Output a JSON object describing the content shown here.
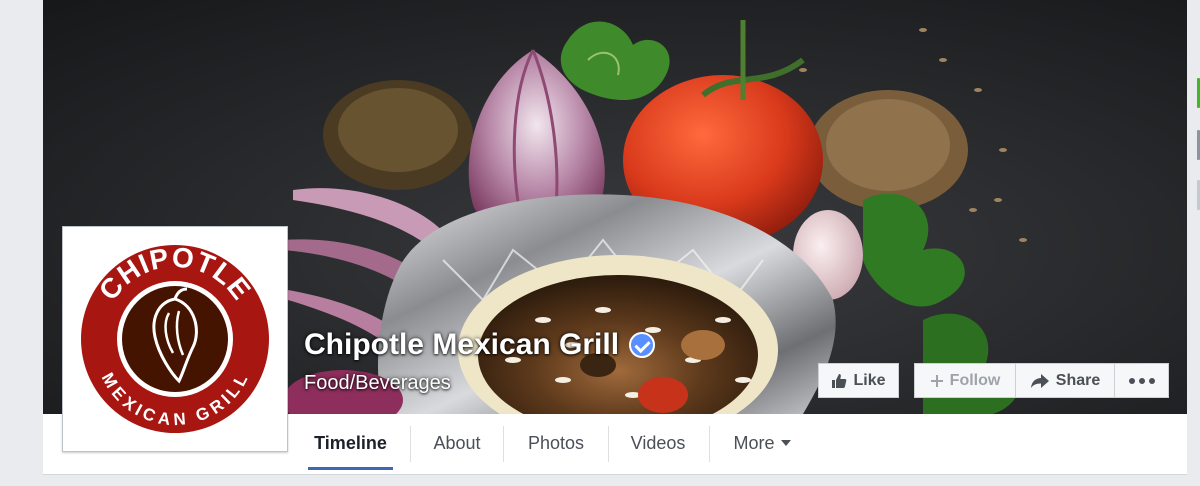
{
  "page": {
    "name": "Chipotle Mexican Grill",
    "category": "Food/Beverages",
    "verified": true
  },
  "logo": {
    "text_top": "CHIPOTLE",
    "text_bottom": "MEXICAN GRILL",
    "ring_color": "#a81612",
    "center_color": "#451400"
  },
  "actions": {
    "like_label": "Like",
    "follow_label": "Follow",
    "share_label": "Share",
    "more_icon": "ellipsis-icon"
  },
  "tabs": [
    {
      "label": "Timeline",
      "active": true
    },
    {
      "label": "About",
      "active": false
    },
    {
      "label": "Photos",
      "active": false
    },
    {
      "label": "Videos",
      "active": false
    },
    {
      "label": "More",
      "active": false
    }
  ],
  "colors": {
    "active_tab_underline": "#4267b2",
    "verified_badge": "#5890ff"
  }
}
